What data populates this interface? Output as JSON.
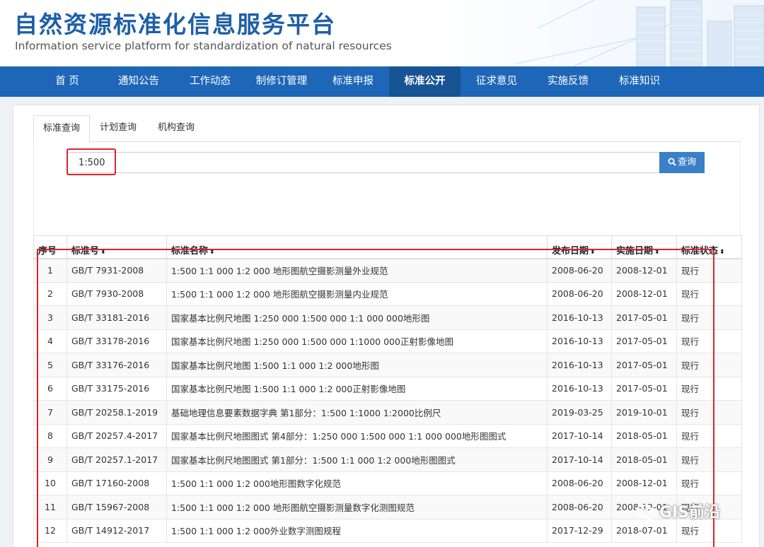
{
  "header": {
    "title_cn": "自然资源标准化信息服务平台",
    "title_en": "Information service platform for standardization of natural resources"
  },
  "nav": {
    "items": [
      {
        "label": "首 页",
        "active": false
      },
      {
        "label": "通知公告",
        "active": false
      },
      {
        "label": "工作动态",
        "active": false
      },
      {
        "label": "制修订管理",
        "active": false
      },
      {
        "label": "标准申报",
        "active": false
      },
      {
        "label": "标准公开",
        "active": true
      },
      {
        "label": "征求意见",
        "active": false
      },
      {
        "label": "实施反馈",
        "active": false
      },
      {
        "label": "标准知识",
        "active": false
      }
    ]
  },
  "tabs": {
    "items": [
      {
        "label": "标准查询",
        "active": true
      },
      {
        "label": "计划查询",
        "active": false
      },
      {
        "label": "机构查询",
        "active": false
      }
    ]
  },
  "search": {
    "value": "1:500",
    "button_label": "查询"
  },
  "table": {
    "columns": [
      "序号",
      "标准号",
      "标准名称",
      "发布日期",
      "实施日期",
      "标准状态"
    ],
    "sortable": [
      false,
      true,
      true,
      true,
      true,
      true
    ],
    "sort_glyph": "⬍",
    "rows": [
      [
        "1",
        "GB/T 7931-2008",
        "1:500 1:1 000 1:2 000 地形图航空摄影测量外业规范",
        "2008-06-20",
        "2008-12-01",
        "现行"
      ],
      [
        "2",
        "GB/T 7930-2008",
        "1:500 1:1 000 1:2 000 地形图航空摄影测量内业规范",
        "2008-06-20",
        "2008-12-01",
        "现行"
      ],
      [
        "3",
        "GB/T 33181-2016",
        "国家基本比例尺地图 1:250 000 1:500 000 1:1 000 000地形图",
        "2016-10-13",
        "2017-05-01",
        "现行"
      ],
      [
        "4",
        "GB/T 33178-2016",
        "国家基本比例尺地图 1:250 000 1:500 000 1:1000 000正射影像地图",
        "2016-10-13",
        "2017-05-01",
        "现行"
      ],
      [
        "5",
        "GB/T 33176-2016",
        "国家基本比例尺地图 1:500 1:1 000 1:2 000地形图",
        "2016-10-13",
        "2017-05-01",
        "现行"
      ],
      [
        "6",
        "GB/T 33175-2016",
        "国家基本比例尺地图 1:500 1:1 000 1:2 000正射影像地图",
        "2016-10-13",
        "2017-05-01",
        "现行"
      ],
      [
        "7",
        "GB/T 20258.1-2019",
        "基础地理信息要素数据字典 第1部分：1:500 1:1000 1:2000比例尺",
        "2019-03-25",
        "2019-10-01",
        "现行"
      ],
      [
        "8",
        "GB/T 20257.4-2017",
        "国家基本比例尺地图图式 第4部分：1:250 000 1:500 000 1:1 000 000地形图图式",
        "2017-10-14",
        "2018-05-01",
        "现行"
      ],
      [
        "9",
        "GB/T 20257.1-2017",
        "国家基本比例尺地图图式 第1部分：1:500 1:1 000 1:2 000地形图图式",
        "2017-10-14",
        "2018-05-01",
        "现行"
      ],
      [
        "10",
        "GB/T 17160-2008",
        "1:500 1:1 000 1:2 000地形图数字化规范",
        "2008-06-20",
        "2008-12-01",
        "现行"
      ],
      [
        "11",
        "GB/T 15967-2008",
        "1:500 1:1 000 1:2 000 地形图航空摄影测量数字化测图规范",
        "2008-06-20",
        "2008-12-01",
        "现行"
      ],
      [
        "12",
        "GB/T 14912-2017",
        "1:500 1:1 000 1:2 000外业数字测图规程",
        "2017-12-29",
        "2018-07-01",
        "现行"
      ]
    ]
  },
  "watermark": {
    "text": "GIS前沿"
  },
  "colors": {
    "brand_blue": "#1e66b8",
    "nav_active": "#165494",
    "highlight_red": "#d9252a",
    "button_blue": "#3a80c8"
  }
}
